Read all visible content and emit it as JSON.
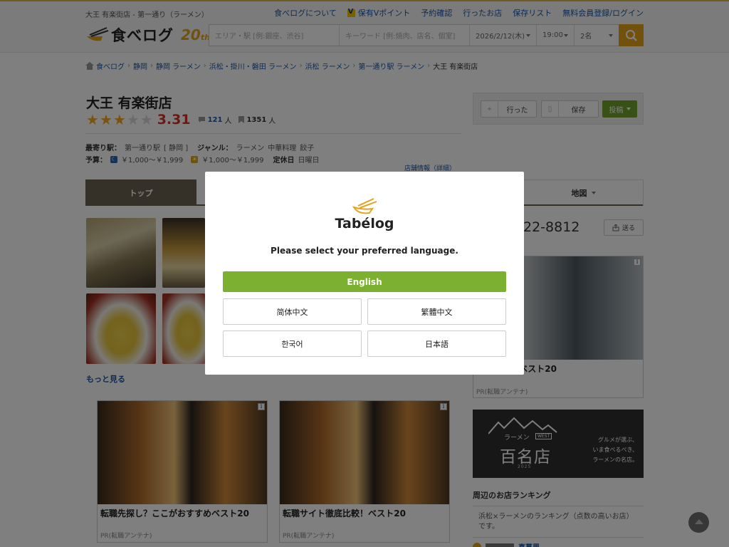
{
  "header": {
    "tagline": "大王 有楽街店 - 第一通り（ラーメン）",
    "nav": [
      {
        "label": "食べログについて"
      },
      {
        "label": "保有Vポイント"
      },
      {
        "label": "予約確認"
      },
      {
        "label": "行ったお店"
      },
      {
        "label": "保存リスト"
      },
      {
        "label": "無料会員登録/ログイン"
      }
    ],
    "logo_text": "食べログ",
    "anniversary": "20",
    "anniversary_suffix": "th"
  },
  "search": {
    "area_placeholder": "エリア・駅 [例:銀座、渋谷]",
    "keyword_placeholder": "キーワード [例:焼肉、店名、個室]",
    "date": "2026/2/12(木)",
    "time": "19:00",
    "people": "2名"
  },
  "breadcrumb": [
    "食べログ",
    "静岡",
    "静岡 ラーメン",
    "浜松・掛川・磐田 ラーメン",
    "浜松 ラーメン",
    "第一通り駅 ラーメン",
    "大王 有楽街店"
  ],
  "restaurant": {
    "name": "大王 有楽街店",
    "rating": 3.31,
    "rating_text": "3.31",
    "review_count": "121",
    "review_unit": "人",
    "save_count": "1351",
    "save_unit": "人",
    "station_label": "最寄り駅：",
    "station": "第一通り駅",
    "station_pref": "[ 静岡 ]",
    "genre_label": "ジャンル：",
    "genres": [
      "ラーメン",
      "中華料理",
      "餃子"
    ],
    "budget_label": "予算：",
    "budget_night": "￥1,000～￥1,999",
    "budget_day": "￥1,000～￥1,999",
    "holiday_label": "定休日",
    "holiday": "日曜日",
    "detail_link": "店舗情報（詳細）"
  },
  "actions": {
    "went": "行った",
    "save": "保存",
    "post": "投稿"
  },
  "tabs": {
    "top": "トップ",
    "map": "地図"
  },
  "phone_partial": "22-8812",
  "send_label": "送る",
  "more_link": "もっと見る",
  "ads": {
    "right_title": "徹底比較！ベスト20",
    "right_pr": "PR(転職アンテナ)",
    "left_title": "転職先探し？ここがおすすめベスト20",
    "left_pr": "PR(転職アンテナ)",
    "mid_title": "転職サイト徹底比較！ベスト20",
    "mid_pr": "PR(転職アンテナ)",
    "info_glyph": "i"
  },
  "banner": {
    "small": "ラーメン",
    "west": "WEST",
    "big": "百名店",
    "year": "2025",
    "copy_line1": "グルメが選ぶ、",
    "copy_line2": "いま食べるべき、",
    "copy_line3": "ラーメンの名店。"
  },
  "ranking": {
    "title": "周辺のお店ランキング",
    "description": "浜松×ラーメンのランキング（点数の高いお店）です。",
    "first_item": "喜慕里"
  },
  "modal": {
    "logo_text": "Tabélog",
    "prompt": "Please select your preferred language.",
    "languages": {
      "english": "English",
      "zh_hans": "简体中文",
      "zh_hant": "繁體中文",
      "korean": "한국어",
      "japanese": "日本語"
    }
  },
  "colors": {
    "accent": "#e5a21b",
    "english_button": "#7cb031",
    "post_button": "#6fa32c",
    "score": "#d93125",
    "tab_active": "#6b6352"
  }
}
